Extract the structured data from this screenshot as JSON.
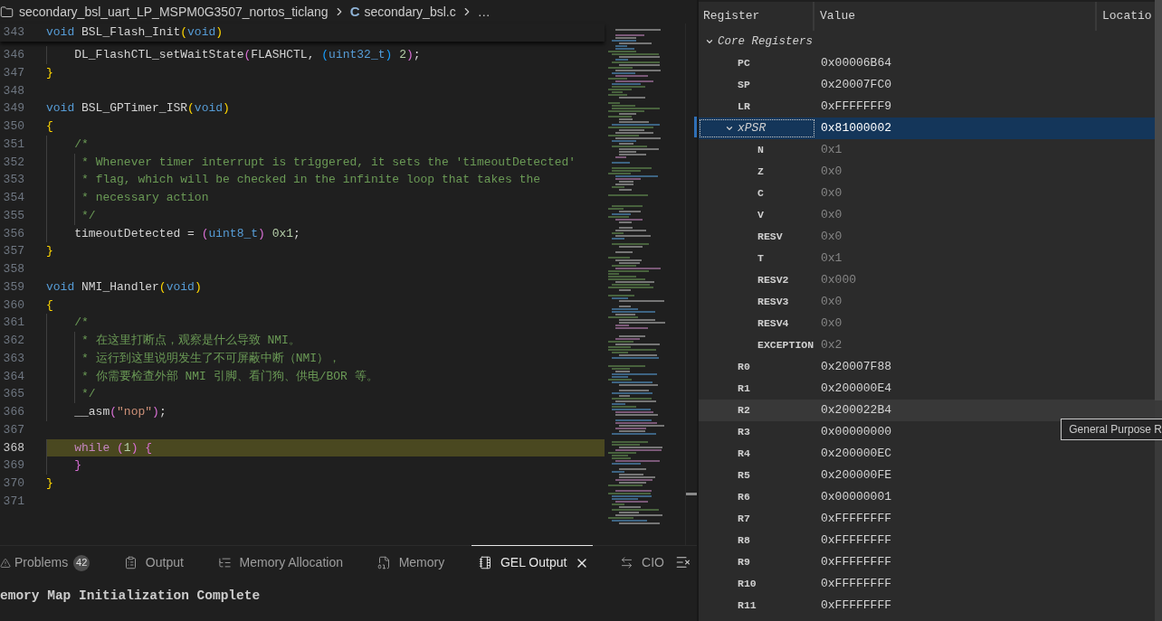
{
  "breadcrumb": [
    {
      "kind": "folder",
      "label": "secondary_bsl_uart_LP_MSPM0G3507_nortos_ticlang"
    },
    {
      "kind": "file",
      "badge": "C",
      "label": "secondary_bsl.c"
    },
    {
      "kind": "more",
      "label": "…"
    }
  ],
  "editor": {
    "sticky_line": {
      "number": "343",
      "tokens": [
        {
          "kind": "keyword",
          "text": "void"
        },
        {
          "kind": "plain",
          "text": " BSL_Flash_Init"
        },
        {
          "kind": "bracket1",
          "text": "("
        },
        {
          "kind": "keyword",
          "text": "void"
        },
        {
          "kind": "bracket1",
          "text": ")"
        }
      ]
    },
    "lines": [
      {
        "number": "346",
        "highlighted": false,
        "tokens": [
          {
            "kind": "plain",
            "text": "    DL_FlashCTL_setWaitState"
          },
          {
            "kind": "bracket2",
            "text": "("
          },
          {
            "kind": "plain",
            "text": "FLASHCTL, "
          },
          {
            "kind": "bracket3",
            "text": "("
          },
          {
            "kind": "keyword",
            "text": "uint32_t"
          },
          {
            "kind": "bracket3",
            "text": ")"
          },
          {
            "kind": "number",
            "text": " 2"
          },
          {
            "kind": "bracket2",
            "text": ")"
          },
          {
            "kind": "plain",
            "text": ";"
          }
        ]
      },
      {
        "number": "347",
        "highlighted": false,
        "tokens": [
          {
            "kind": "bracket1",
            "text": "}"
          }
        ]
      },
      {
        "number": "348",
        "highlighted": false
      },
      {
        "number": "349",
        "highlighted": false,
        "tokens": [
          {
            "kind": "keyword",
            "text": "void"
          },
          {
            "kind": "plain",
            "text": " BSL_GPTimer_ISR"
          },
          {
            "kind": "bracket1",
            "text": "("
          },
          {
            "kind": "keyword",
            "text": "void"
          },
          {
            "kind": "bracket1",
            "text": ")"
          }
        ]
      },
      {
        "number": "350",
        "highlighted": false,
        "tokens": [
          {
            "kind": "bracket1",
            "text": "{"
          }
        ]
      },
      {
        "number": "351",
        "highlighted": false,
        "tokens": [
          {
            "kind": "comment",
            "text": "    /*"
          }
        ]
      },
      {
        "number": "352",
        "highlighted": false,
        "tokens": [
          {
            "kind": "comment",
            "text": "     * Whenever timer interrupt is triggered, it sets the 'timeoutDetected'"
          }
        ]
      },
      {
        "number": "353",
        "highlighted": false,
        "tokens": [
          {
            "kind": "comment",
            "text": "     * flag, which will be checked in the infinite loop that takes the"
          }
        ]
      },
      {
        "number": "354",
        "highlighted": false,
        "tokens": [
          {
            "kind": "comment",
            "text": "     * necessary action"
          }
        ]
      },
      {
        "number": "355",
        "highlighted": false,
        "tokens": [
          {
            "kind": "comment",
            "text": "     */"
          }
        ]
      },
      {
        "number": "356",
        "highlighted": false,
        "tokens": [
          {
            "kind": "plain",
            "text": "    timeoutDetected = "
          },
          {
            "kind": "bracket2",
            "text": "("
          },
          {
            "kind": "keyword",
            "text": "uint8_t"
          },
          {
            "kind": "bracket2",
            "text": ")"
          },
          {
            "kind": "number",
            "text": " 0x1"
          },
          {
            "kind": "plain",
            "text": ";"
          }
        ]
      },
      {
        "number": "357",
        "highlighted": false,
        "tokens": [
          {
            "kind": "bracket1",
            "text": "}"
          }
        ]
      },
      {
        "number": "358",
        "highlighted": false
      },
      {
        "number": "359",
        "highlighted": false,
        "tokens": [
          {
            "kind": "keyword",
            "text": "void"
          },
          {
            "kind": "plain",
            "text": " NMI_Handler"
          },
          {
            "kind": "bracket1",
            "text": "("
          },
          {
            "kind": "keyword",
            "text": "void"
          },
          {
            "kind": "bracket1",
            "text": ")"
          }
        ]
      },
      {
        "number": "360",
        "highlighted": false,
        "tokens": [
          {
            "kind": "bracket1",
            "text": "{"
          }
        ]
      },
      {
        "number": "361",
        "highlighted": false,
        "tokens": [
          {
            "kind": "comment",
            "text": "    /*"
          }
        ]
      },
      {
        "number": "362",
        "highlighted": false,
        "tokens": [
          {
            "kind": "comment",
            "text": "     * 在这里打断点，观察是什么导致 NMI。"
          }
        ]
      },
      {
        "number": "363",
        "highlighted": false,
        "tokens": [
          {
            "kind": "comment",
            "text": "     * 运行到这里说明发生了不可屏蔽中断（NMI），"
          }
        ]
      },
      {
        "number": "364",
        "highlighted": false,
        "tokens": [
          {
            "kind": "comment",
            "text": "     * 你需要检查外部 NMI 引脚、看门狗、供电/BOR 等。"
          }
        ]
      },
      {
        "number": "365",
        "highlighted": false,
        "tokens": [
          {
            "kind": "comment",
            "text": "     */"
          }
        ]
      },
      {
        "number": "366",
        "highlighted": false,
        "tokens": [
          {
            "kind": "plain",
            "text": "    __asm"
          },
          {
            "kind": "bracket2",
            "text": "("
          },
          {
            "kind": "string",
            "text": "\"nop\""
          },
          {
            "kind": "bracket2",
            "text": ")"
          },
          {
            "kind": "plain",
            "text": ";"
          }
        ]
      },
      {
        "number": "367",
        "highlighted": false
      },
      {
        "number": "368",
        "highlighted": true,
        "tokens": [
          {
            "kind": "control",
            "text": "    while"
          },
          {
            "kind": "bracket2",
            "text": " ("
          },
          {
            "kind": "number",
            "text": "1"
          },
          {
            "kind": "bracket2",
            "text": ")"
          },
          {
            "kind": "bracket2",
            "text": " {"
          }
        ]
      },
      {
        "number": "369",
        "highlighted": false,
        "tokens": [
          {
            "kind": "bracket2",
            "text": "    }"
          }
        ]
      },
      {
        "number": "370",
        "highlighted": false,
        "tokens": [
          {
            "kind": "bracket1",
            "text": "}"
          }
        ]
      },
      {
        "number": "371",
        "highlighted": false
      }
    ]
  },
  "panel": {
    "tabs": [
      {
        "kind": "problems",
        "label": "Problems",
        "badge": "42",
        "selected": false
      },
      {
        "kind": "output",
        "label": "Output",
        "selected": false
      },
      {
        "kind": "memory-allocation",
        "label": "Memory Allocation",
        "selected": false
      },
      {
        "kind": "memory",
        "label": "Memory",
        "selected": false
      },
      {
        "kind": "gel-output",
        "label": "GEL Output",
        "selected": true
      },
      {
        "kind": "cio",
        "label": "CIO",
        "selected": false
      }
    ],
    "output_lines": [
      "emory Map Initialization Complete"
    ]
  },
  "registers": {
    "columns": [
      "Register",
      "Value",
      "Locatio"
    ],
    "groups": [
      {
        "label": "Core Registers",
        "expanded": true,
        "rows": [
          {
            "name": "PC",
            "value": "0x00006B64",
            "selected": false,
            "hovered": false
          },
          {
            "name": "SP",
            "value": "0x20007FC0",
            "selected": false,
            "hovered": false
          },
          {
            "name": "LR",
            "value": "0xFFFFFFF9",
            "selected": false,
            "hovered": false
          },
          {
            "name": "xPSR",
            "value": "0x81000002",
            "selected": true,
            "hovered": false,
            "expanded": true,
            "children": [
              {
                "name": "N",
                "value": "0x1",
                "selected": false,
                "hovered": false
              },
              {
                "name": "Z",
                "value": "0x0",
                "selected": false,
                "hovered": false
              },
              {
                "name": "C",
                "value": "0x0",
                "selected": false,
                "hovered": false
              },
              {
                "name": "V",
                "value": "0x0",
                "selected": false,
                "hovered": false
              },
              {
                "name": "RESV",
                "value": "0x0",
                "selected": false,
                "hovered": false
              },
              {
                "name": "T",
                "value": "0x1",
                "selected": false,
                "hovered": false
              },
              {
                "name": "RESV2",
                "value": "0x000",
                "selected": false,
                "hovered": false
              },
              {
                "name": "RESV3",
                "value": "0x0",
                "selected": false,
                "hovered": false
              },
              {
                "name": "RESV4",
                "value": "0x0",
                "selected": false,
                "hovered": false
              },
              {
                "name": "EXCEPTION",
                "value": "0x2",
                "selected": false,
                "hovered": false
              }
            ]
          },
          {
            "name": "R0",
            "value": "0x20007F88",
            "selected": false,
            "hovered": false
          },
          {
            "name": "R1",
            "value": "0x200000E4",
            "selected": false,
            "hovered": false
          },
          {
            "name": "R2",
            "value": "0x200022B4",
            "selected": false,
            "hovered": true,
            "tooltip": "General Purpose R"
          },
          {
            "name": "R3",
            "value": "0x00000000",
            "selected": false,
            "hovered": false
          },
          {
            "name": "R4",
            "value": "0x200000EC",
            "selected": false,
            "hovered": false
          },
          {
            "name": "R5",
            "value": "0x200000FE",
            "selected": false,
            "hovered": false
          },
          {
            "name": "R6",
            "value": "0x00000001",
            "selected": false,
            "hovered": false
          },
          {
            "name": "R7",
            "value": "0xFFFFFFFF",
            "selected": false,
            "hovered": false
          },
          {
            "name": "R8",
            "value": "0xFFFFFFFF",
            "selected": false,
            "hovered": false
          },
          {
            "name": "R9",
            "value": "0xFFFFFFFF",
            "selected": false,
            "hovered": false
          },
          {
            "name": "R10",
            "value": "0xFFFFFFFF",
            "selected": false,
            "hovered": false
          },
          {
            "name": "R11",
            "value": "0xFFFFFFFF",
            "selected": false,
            "hovered": false
          }
        ]
      }
    ]
  }
}
